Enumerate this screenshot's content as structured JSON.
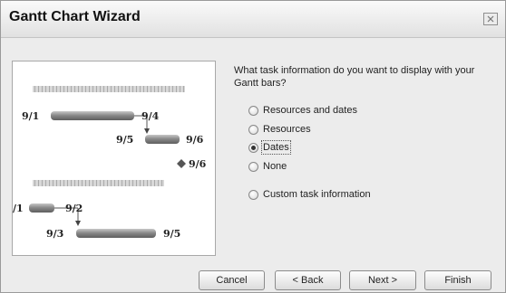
{
  "dialog": {
    "title": "Gantt Chart Wizard"
  },
  "question": "What task information do you want to display with your Gantt bars?",
  "options": [
    {
      "label": "Resources and dates",
      "selected": false
    },
    {
      "label": "Resources",
      "selected": false
    },
    {
      "label": "Dates",
      "selected": true
    },
    {
      "label": "None",
      "selected": false
    },
    {
      "label": "Custom task information",
      "selected": false
    }
  ],
  "preview": {
    "labels": {
      "a_start": "9/1",
      "a_end": "9/4",
      "b_start": "9/5",
      "b_end": "9/6",
      "milestone": "9/6",
      "c_start": "/1",
      "c_end": "9/2",
      "d_start": "9/3",
      "d_end": "9/5"
    }
  },
  "buttons": {
    "cancel": "Cancel",
    "back": "< Back",
    "next": "Next >",
    "finish": "Finish"
  }
}
